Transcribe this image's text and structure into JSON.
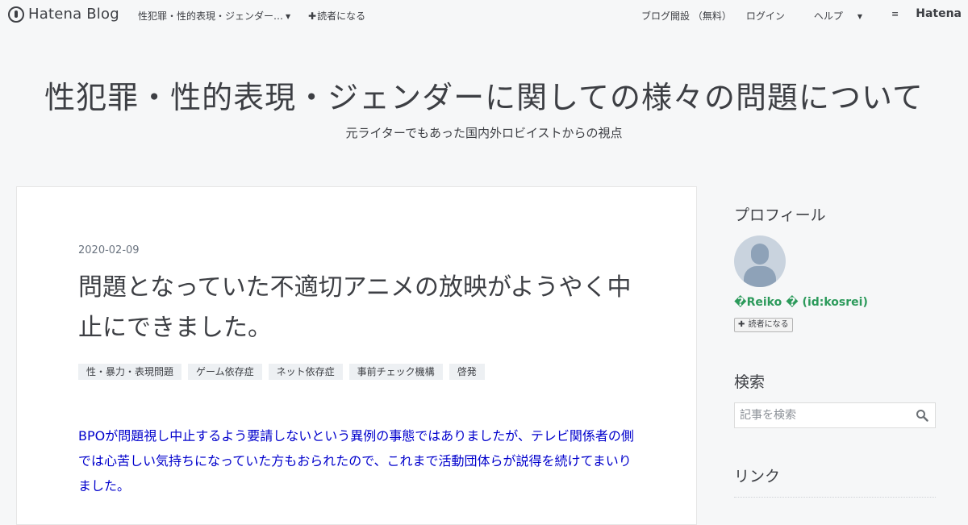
{
  "topbar": {
    "brand": "Hatena Blog",
    "blog_menu": "性犯罪・性的表現・ジェンダー…",
    "subscribe": "読者になる",
    "start_blog": "ブログ開設 （無料）",
    "login": "ログイン",
    "help": "ヘルプ",
    "hatena": "Hatena",
    "icons": [
      "hatena-blog-logo-icon",
      "caret-down-icon",
      "plus-icon",
      "hatena-logo-icon"
    ]
  },
  "header": {
    "title": "性犯罪・性的表現・ジェンダーに関しての様々の問題について",
    "description": "元ライターでもあった国内外ロビイストからの視点"
  },
  "entry": {
    "date": "2020-02-09",
    "title": "問題となっていた不適切アニメの放映がようやく中止にできました。",
    "tags": [
      "性・暴力・表現問題",
      "ゲーム依存症",
      "ネット依存症",
      "事前チェック機構",
      "啓発"
    ],
    "body": "BPOが問題視し中止するよう要請しないという異例の事態ではありましたが、テレビ関係者の側では心苦しい気持ちになっていた方もおられたので、これまで活動団体らが説得を続けてまいりました。"
  },
  "sidebar": {
    "profile_heading": "プロフィール",
    "user_id": "�Reiko � (id:kosrei)",
    "subscribe_button": "読者になる",
    "search_heading": "検索",
    "search_placeholder": "記事を検索",
    "link_heading": "リンク"
  },
  "colors": {
    "background": "#f6f7f8",
    "text": "#3d3f44",
    "link_text": "#0000cc",
    "user_id": "#2c9a5b",
    "tag_background": "#edf0f3"
  }
}
